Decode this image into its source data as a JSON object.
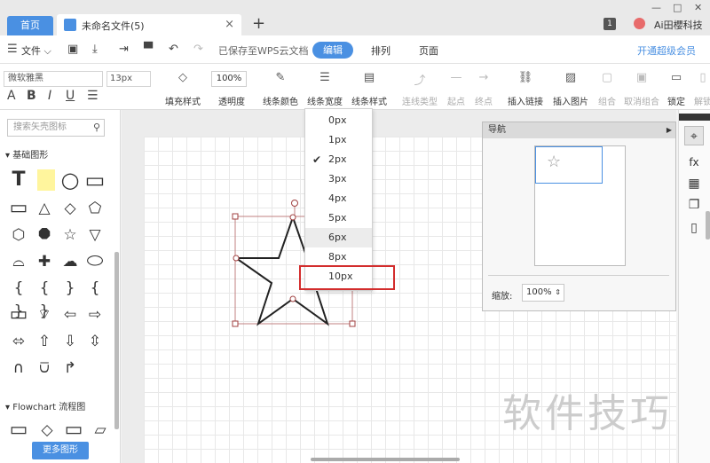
{
  "tabs": {
    "home": "首页",
    "document": "未命名文件(5)",
    "add": "+",
    "close": "×"
  },
  "window": {
    "badge": "1",
    "user": "Ai田櫻科技",
    "minimize": "—",
    "maximize": "□",
    "close": "✕"
  },
  "menu": {
    "file": "文件 ⌵",
    "saved": "已保存至WPS云文档",
    "edit": "编辑",
    "arrange": "排列",
    "page": "页面",
    "vip": "开通超级会员"
  },
  "toolbar": {
    "font": "微软雅黑",
    "font_size": "13px",
    "format_a": "A",
    "bold": "B",
    "italic": "I",
    "underline": "U",
    "align": "☰",
    "fill_style": "填充样式",
    "opacity_value": "100%",
    "opacity": "透明度",
    "line_color": "线条颜色",
    "line_width": "线条宽度",
    "line_style": "线条样式",
    "connector_type": "连线类型",
    "start_point": "起点",
    "end_point": "终点",
    "insert_link": "插入链接",
    "insert_image": "插入图片",
    "group": "组合",
    "ungroup": "取消组合",
    "lock": "锁定",
    "unlock": "解锁"
  },
  "sidebar": {
    "search_placeholder": "搜索矢壳图标",
    "basic_shapes": "▾ 基础图形",
    "flowchart": "▾ Flowchart 流程图",
    "more_shapes": "更多图形"
  },
  "dropdown": {
    "selected": "2px",
    "highlighted": "10px",
    "options": [
      "0px",
      "1px",
      "2px",
      "3px",
      "4px",
      "5px",
      "6px",
      "8px",
      "10px"
    ]
  },
  "nav_panel": {
    "title": "导航",
    "zoom_label": "缩放:",
    "zoom_value": "100%"
  },
  "watermark": "软件技巧",
  "colors": {
    "accent": "#4a90e2",
    "highlight": "#d32d2d"
  }
}
